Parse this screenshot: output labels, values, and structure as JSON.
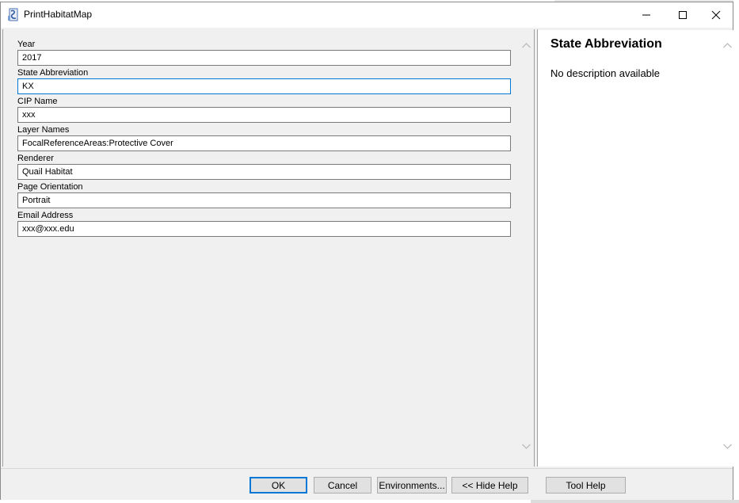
{
  "window": {
    "title": "PrintHabitatMap"
  },
  "titlebar_buttons": {
    "minimize_icon": "minimize-icon",
    "maximize_icon": "maximize-icon",
    "close_icon": "close-icon"
  },
  "fields": [
    {
      "label": "Year",
      "value": "2017"
    },
    {
      "label": "State Abbreviation",
      "value": "KX"
    },
    {
      "label": "CIP Name",
      "value": "xxx"
    },
    {
      "label": "Layer Names",
      "value": "FocalReferenceAreas:Protective Cover"
    },
    {
      "label": "Renderer",
      "value": "Quail Habitat"
    },
    {
      "label": "Page Orientation",
      "value": "Portrait"
    },
    {
      "label": "Email Address",
      "value": "xxx@xxx.edu"
    }
  ],
  "help": {
    "title": "State Abbreviation",
    "description": "No description available"
  },
  "buttons": {
    "ok": "OK",
    "cancel": "Cancel",
    "environments": "Environments...",
    "hide_help": "<< Hide Help",
    "tool_help": "Tool Help"
  },
  "colors": {
    "focus_border": "#0078d7",
    "dialog_bg": "#f0f0f0"
  }
}
